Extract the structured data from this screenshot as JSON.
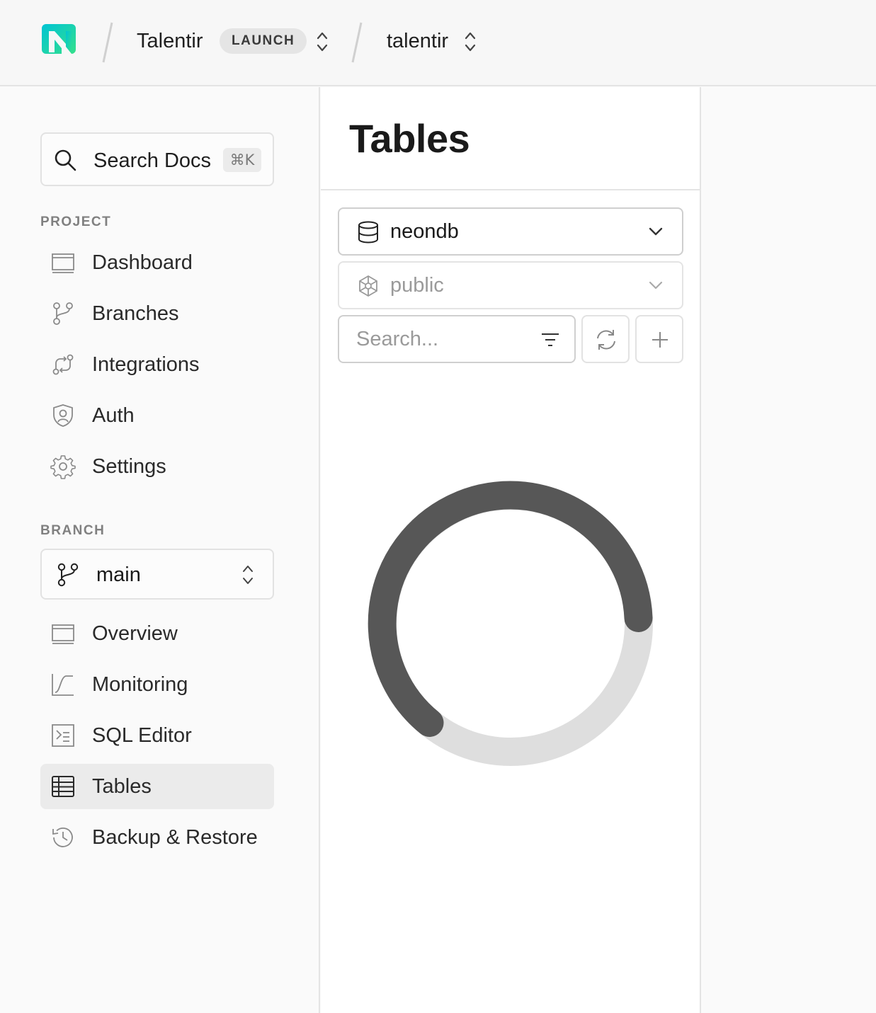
{
  "header": {
    "logo": "neon-logo-icon",
    "org_name": "Talentir",
    "org_plan_badge": "LAUNCH",
    "project_name": "talentir"
  },
  "sidebar": {
    "search": {
      "label": "Search Docs",
      "shortcut": "⌘K",
      "icon": "search-icon"
    },
    "project_section": {
      "title": "PROJECT",
      "items": [
        {
          "label": "Dashboard",
          "icon": "dashboard-icon"
        },
        {
          "label": "Branches",
          "icon": "branches-icon"
        },
        {
          "label": "Integrations",
          "icon": "integrations-icon"
        },
        {
          "label": "Auth",
          "icon": "auth-shield-icon"
        },
        {
          "label": "Settings",
          "icon": "gear-icon"
        }
      ]
    },
    "branch_section": {
      "title": "BRANCH",
      "selected_branch": "main",
      "items": [
        {
          "label": "Overview",
          "icon": "overview-icon"
        },
        {
          "label": "Monitoring",
          "icon": "monitoring-icon"
        },
        {
          "label": "SQL Editor",
          "icon": "sql-editor-icon"
        },
        {
          "label": "Tables",
          "icon": "table-icon",
          "active": true
        },
        {
          "label": "Backup & Restore",
          "icon": "history-icon"
        }
      ]
    }
  },
  "main": {
    "title": "Tables",
    "database_select": {
      "value": "neondb",
      "icon": "database-icon"
    },
    "schema_select": {
      "value": "public",
      "icon": "schema-icon",
      "disabled": true
    },
    "search": {
      "placeholder": "Search..."
    },
    "loading": true
  },
  "colors": {
    "spinner_active": "#575757",
    "spinner_track": "#dedede",
    "logo_green": "#34e08b",
    "logo_teal": "#00c4d4"
  }
}
